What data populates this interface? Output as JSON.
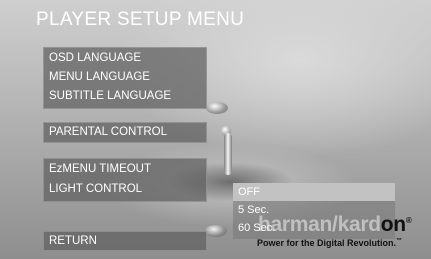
{
  "screen": {
    "title": "PLAYER SETUP MENU"
  },
  "menu": {
    "osd_language": "OSD LANGUAGE",
    "menu_language": "MENU LANGUAGE",
    "subtitle_language": "SUBTITLE LANGUAGE",
    "parental_control": "PARENTAL CONTROL",
    "ezmenu_timeout": "EzMENU TIMEOUT",
    "light_control": "LIGHT CONTROL",
    "return": "RETURN"
  },
  "light_control_options": {
    "selected": "OFF",
    "items": [
      "OFF",
      "5 Sec.",
      "60 Sec."
    ]
  },
  "brand": {
    "logo_start": "harman/kard",
    "logo_end": "on",
    "registered": "®",
    "tagline": "Power for the Digital Revolution.",
    "trademark": "™"
  },
  "colors": {
    "menu_box": "#606060",
    "selected_option": "#c2c2c2",
    "text": "#ffffff"
  },
  "icons": {
    "background": "water-droplet-image"
  }
}
